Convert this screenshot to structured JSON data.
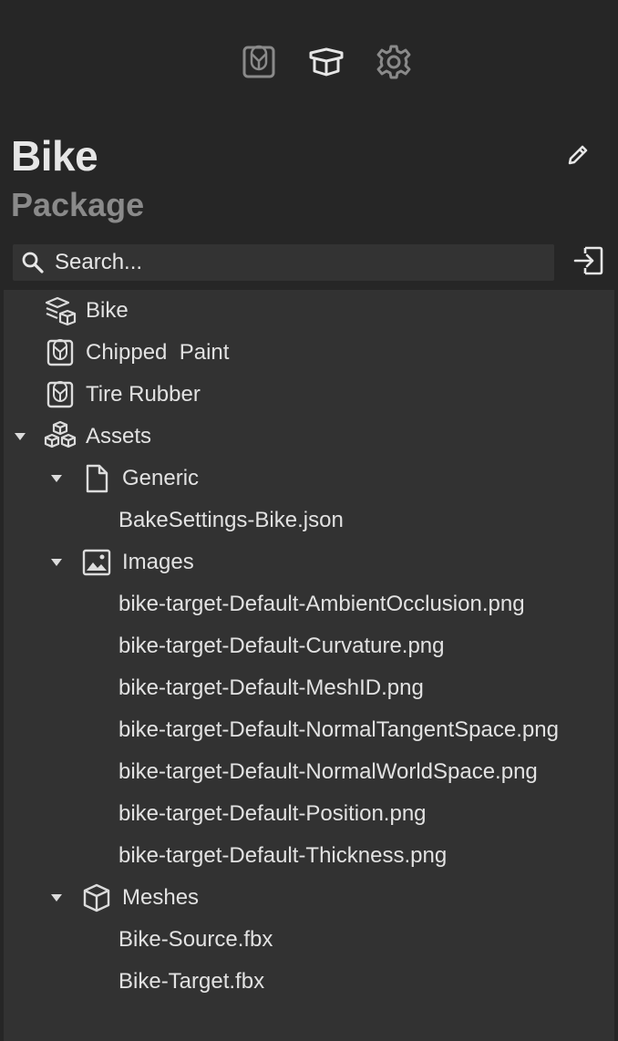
{
  "toolbar": {
    "buttons": [
      {
        "icon": "material-icon",
        "active": false
      },
      {
        "icon": "package-box-icon",
        "active": true
      },
      {
        "icon": "gear-icon",
        "active": false
      }
    ]
  },
  "header": {
    "title": "Bike",
    "subtitle": "Package",
    "edit_icon": "pencil-icon"
  },
  "search": {
    "placeholder": "Search...",
    "value": "",
    "import_icon": "import-icon"
  },
  "tree": {
    "items": [
      {
        "label": "Bike",
        "icon": "stack-cube-icon",
        "level": 0,
        "expandable": false
      },
      {
        "label": "Chipped  Paint",
        "icon": "material-icon",
        "level": 0,
        "expandable": false
      },
      {
        "label": "Tire Rubber",
        "icon": "material-icon",
        "level": 0,
        "expandable": false
      },
      {
        "label": "Assets",
        "icon": "cubes-icon",
        "level": 0,
        "expandable": true,
        "expanded": true
      },
      {
        "label": "Generic",
        "icon": "file-icon",
        "level": 1,
        "expandable": true,
        "expanded": true
      },
      {
        "label": "BakeSettings-Bike.json",
        "icon": "",
        "level": 2,
        "expandable": false
      },
      {
        "label": "Images",
        "icon": "image-icon",
        "level": 1,
        "expandable": true,
        "expanded": true
      },
      {
        "label": "bike-target-Default-AmbientOcclusion.png",
        "icon": "",
        "level": 2,
        "expandable": false
      },
      {
        "label": "bike-target-Default-Curvature.png",
        "icon": "",
        "level": 2,
        "expandable": false
      },
      {
        "label": "bike-target-Default-MeshID.png",
        "icon": "",
        "level": 2,
        "expandable": false
      },
      {
        "label": "bike-target-Default-NormalTangentSpace.png",
        "icon": "",
        "level": 2,
        "expandable": false
      },
      {
        "label": "bike-target-Default-NormalWorldSpace.png",
        "icon": "",
        "level": 2,
        "expandable": false
      },
      {
        "label": "bike-target-Default-Position.png",
        "icon": "",
        "level": 2,
        "expandable": false
      },
      {
        "label": "bike-target-Default-Thickness.png",
        "icon": "",
        "level": 2,
        "expandable": false
      },
      {
        "label": "Meshes",
        "icon": "cube-icon",
        "level": 1,
        "expandable": true,
        "expanded": true
      },
      {
        "label": "Bike-Source.fbx",
        "icon": "",
        "level": 2,
        "expandable": false
      },
      {
        "label": "Bike-Target.fbx",
        "icon": "",
        "level": 2,
        "expandable": false
      }
    ]
  },
  "colors": {
    "background": "#262626",
    "tree_background": "#323232",
    "search_background": "#333333",
    "text": "#e2e2e2",
    "muted_text": "#8a8a8a",
    "icon": "#dcdcdc",
    "icon_inactive": "#8a8a8a"
  }
}
